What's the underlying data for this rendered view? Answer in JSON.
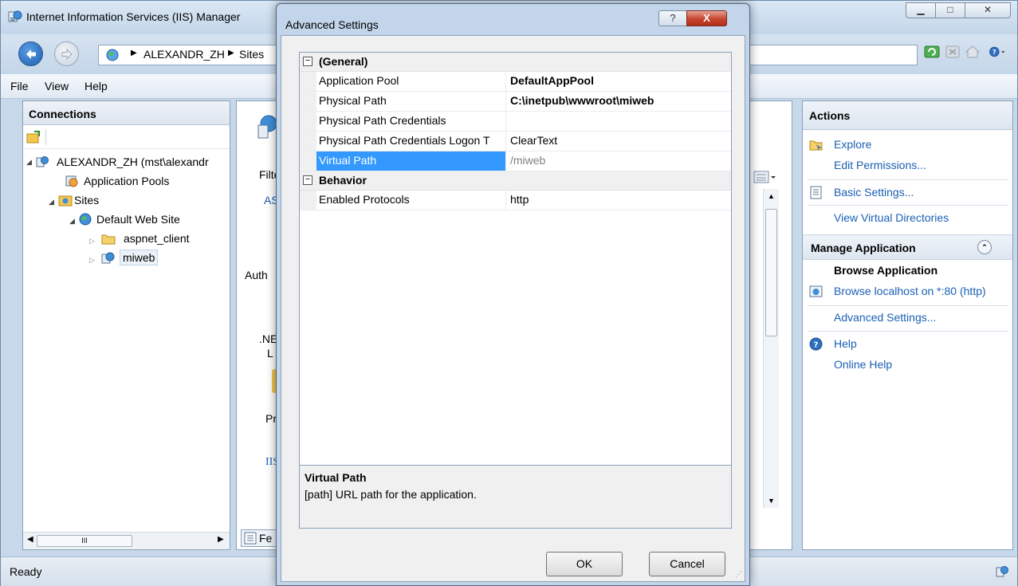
{
  "window": {
    "title": "Internet Information Services (IIS) Manager"
  },
  "nav": {
    "breadcrumb": [
      "ALEXANDR_ZH",
      "Sites"
    ]
  },
  "menu": [
    "File",
    "View",
    "Help"
  ],
  "connections": {
    "header": "Connections",
    "tree": [
      {
        "label": "ALEXANDR_ZH (mst\\alexandr"
      },
      {
        "label": "Application Pools"
      },
      {
        "label": "Sites"
      },
      {
        "label": "Default Web Site"
      },
      {
        "label": "aspnet_client"
      },
      {
        "label": "miweb"
      }
    ],
    "scroll_glyph": "III"
  },
  "center_fragments": {
    "filter": "Filte",
    "as": "AS",
    "auth": "Auth",
    "net_1": ".NE",
    "net_2": "L",
    "pro": "Pro",
    "iis": "IIS",
    "fe": "Fe"
  },
  "actions": {
    "header": "Actions",
    "explore": "Explore",
    "edit_permissions": "Edit Permissions...",
    "basic_settings": "Basic Settings...",
    "view_virtual_directories": "View Virtual Directories",
    "manage_application": "Manage Application",
    "browse_application": "Browse Application",
    "browse_localhost": "Browse localhost on *:80 (http)",
    "advanced_settings": "Advanced Settings...",
    "help": "Help",
    "online_help": "Online Help"
  },
  "status": {
    "text": "Ready"
  },
  "dialog": {
    "title": "Advanced Settings",
    "help_glyph": "?",
    "close_glyph": "X",
    "categories": {
      "general": "(General)",
      "behavior": "Behavior"
    },
    "properties": {
      "app_pool": {
        "name": "Application Pool",
        "value": "DefaultAppPool"
      },
      "physical_path": {
        "name": "Physical Path",
        "value": "C:\\inetpub\\wwwroot\\miweb"
      },
      "ppc": {
        "name": "Physical Path Credentials",
        "value": ""
      },
      "ppc_logon": {
        "name": "Physical Path Credentials Logon T",
        "value": "ClearText"
      },
      "virtual_path": {
        "name": "Virtual Path",
        "value": "/miweb"
      },
      "enabled_protocols": {
        "name": "Enabled Protocols",
        "value": "http"
      }
    },
    "description": {
      "title": "Virtual Path",
      "text": "[path] URL path for the application."
    },
    "ok_label": "OK",
    "cancel_label": "Cancel"
  },
  "colors": {
    "selection": "#3399ff",
    "link": "#1a5fb4",
    "chrome": "#c3d5ea"
  }
}
